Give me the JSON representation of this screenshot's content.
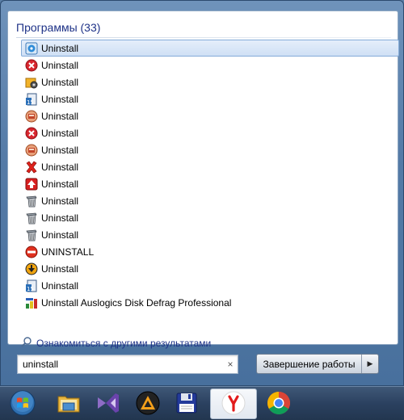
{
  "section": {
    "title": "Программы (33)"
  },
  "results": [
    {
      "label": "Uninstall",
      "icon": "uninstall-blue-disc-icon",
      "selected": true
    },
    {
      "label": "Uninstall",
      "icon": "red-x-circle-icon"
    },
    {
      "label": "Uninstall",
      "icon": "yellow-gear-box-icon"
    },
    {
      "label": "Uninstall",
      "icon": "installer-15-icon"
    },
    {
      "label": "Uninstall",
      "icon": "red-box-circle-icon"
    },
    {
      "label": "Uninstall",
      "icon": "red-x-circle-icon"
    },
    {
      "label": "Uninstall",
      "icon": "red-box-circle-icon"
    },
    {
      "label": "Uninstall",
      "icon": "red-x-icon"
    },
    {
      "label": "Uninstall",
      "icon": "red-up-arrow-icon"
    },
    {
      "label": "Uninstall",
      "icon": "trash-bin-icon"
    },
    {
      "label": "Uninstall",
      "icon": "trash-bin-icon"
    },
    {
      "label": "Uninstall",
      "icon": "trash-bin-icon"
    },
    {
      "label": "UNINSTALL",
      "icon": "no-entry-icon"
    },
    {
      "label": "Uninstall",
      "icon": "orange-down-arrow-icon"
    },
    {
      "label": "Uninstall",
      "icon": "installer-15-icon"
    },
    {
      "label": "Uninstall Auslogics Disk Defrag Professional",
      "icon": "disk-defrag-icon"
    }
  ],
  "more_results": {
    "label": "Ознакомиться с другими результатами"
  },
  "search": {
    "value": "uninstall",
    "clear_glyph": "×"
  },
  "shutdown": {
    "label": "Завершение работы",
    "arrow_glyph": "▶"
  },
  "taskbar": [
    {
      "icon": "windows-start-orb-icon"
    },
    {
      "icon": "file-explorer-icon"
    },
    {
      "icon": "visual-studio-icon"
    },
    {
      "icon": "aimp-player-icon"
    },
    {
      "icon": "floppy-disk-icon"
    },
    {
      "icon": "yandex-browser-icon",
      "active": true
    },
    {
      "icon": "chrome-browser-icon"
    }
  ]
}
